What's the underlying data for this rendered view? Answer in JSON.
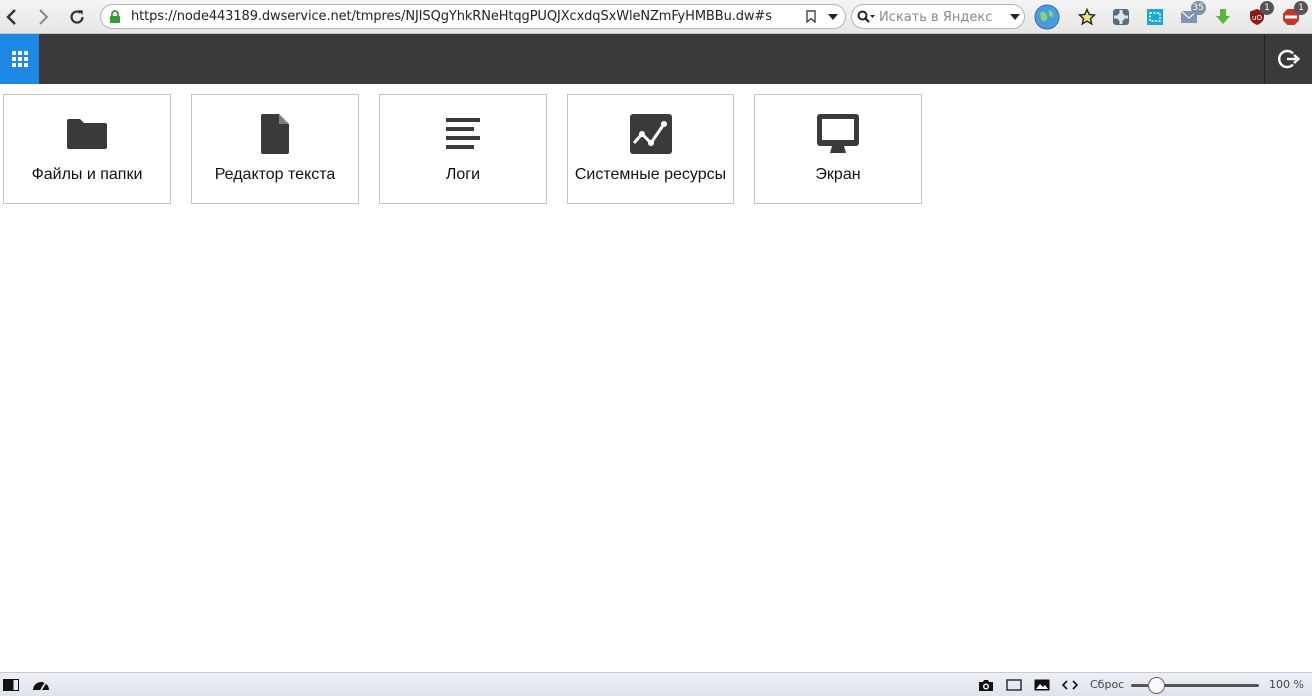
{
  "browser": {
    "url": "https://node443189.dwservice.net/tmpres/NJISQgYhkRNeHtqgPUQJXcxdqSxWleNZmFyHMBBu.dw#s",
    "search_placeholder": "Искать в Яндекс",
    "mail_badge": "35",
    "ublock_badge": "1",
    "adblock_badge": "1"
  },
  "colors": {
    "header_bg": "#3a3a3a",
    "accent": "#1e88e5",
    "icon": "#3a3a3a"
  },
  "tiles": [
    {
      "label": "Файлы и папки",
      "icon": "folder-icon"
    },
    {
      "label": "Редактор текста",
      "icon": "file-icon"
    },
    {
      "label": "Логи",
      "icon": "text-lines-icon"
    },
    {
      "label": "Системные ресурсы",
      "icon": "chart-icon"
    },
    {
      "label": "Экран",
      "icon": "monitor-icon"
    }
  ],
  "status_bar": {
    "reset_label": "Сброс",
    "zoom_label": "100 %",
    "zoom_level": 0.2
  }
}
